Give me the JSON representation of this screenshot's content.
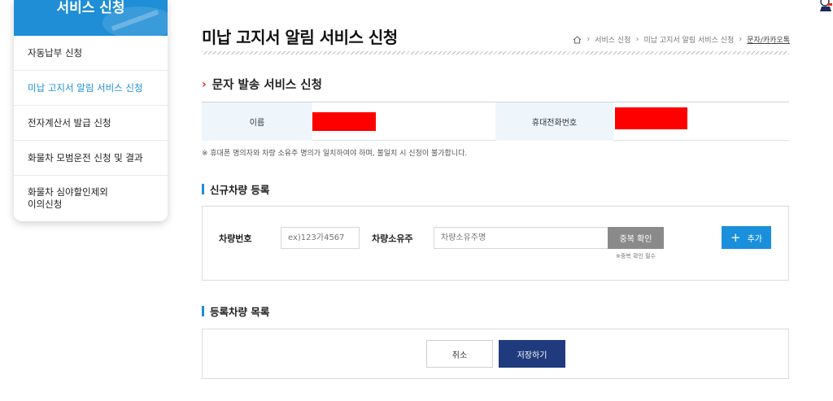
{
  "sidebar": {
    "title": "서비스 신청",
    "items": [
      {
        "label": "자동납부 신청"
      },
      {
        "label": "미납 고지서 알림 서비스 신청"
      },
      {
        "label": "전자계산서 발급 신청"
      },
      {
        "label": "화물차 모범운전 신청 및 결과"
      },
      {
        "label_line1": "화물차 심야할인제외",
        "label_line2": "이의신청"
      }
    ]
  },
  "header": {
    "title": "미납 고지서 알림 서비스 신청",
    "breadcrumb": [
      "서비스 신청",
      "미납 고지서 알림 서비스 신청",
      "문자/카카오톡"
    ]
  },
  "sms_section": {
    "title": "문자 발송 서비스 신청",
    "name_label": "이름",
    "phone_label": "휴대전화번호",
    "notice": "※ 휴대폰 명의자와 차량 소유주 명의가 일치하여야 하며, 불일치 시 신청이 불가합니다."
  },
  "new_vehicle": {
    "title": "신규차량 등록",
    "plate_label": "차량번호",
    "plate_placeholder": "ex)123가4567",
    "owner_label": "차량소유주",
    "owner_placeholder": "차량소유주명",
    "dup_button": "중복 확인",
    "dup_note": "※중복 확인 필수",
    "add_button": "추가"
  },
  "registered": {
    "title": "등록차량 목록"
  },
  "actions": {
    "cancel": "취소",
    "save": "저장하기"
  },
  "colors": {
    "brand_blue": "#1f8ed6",
    "save_navy": "#203b7d",
    "redaction": "#ff0000"
  }
}
